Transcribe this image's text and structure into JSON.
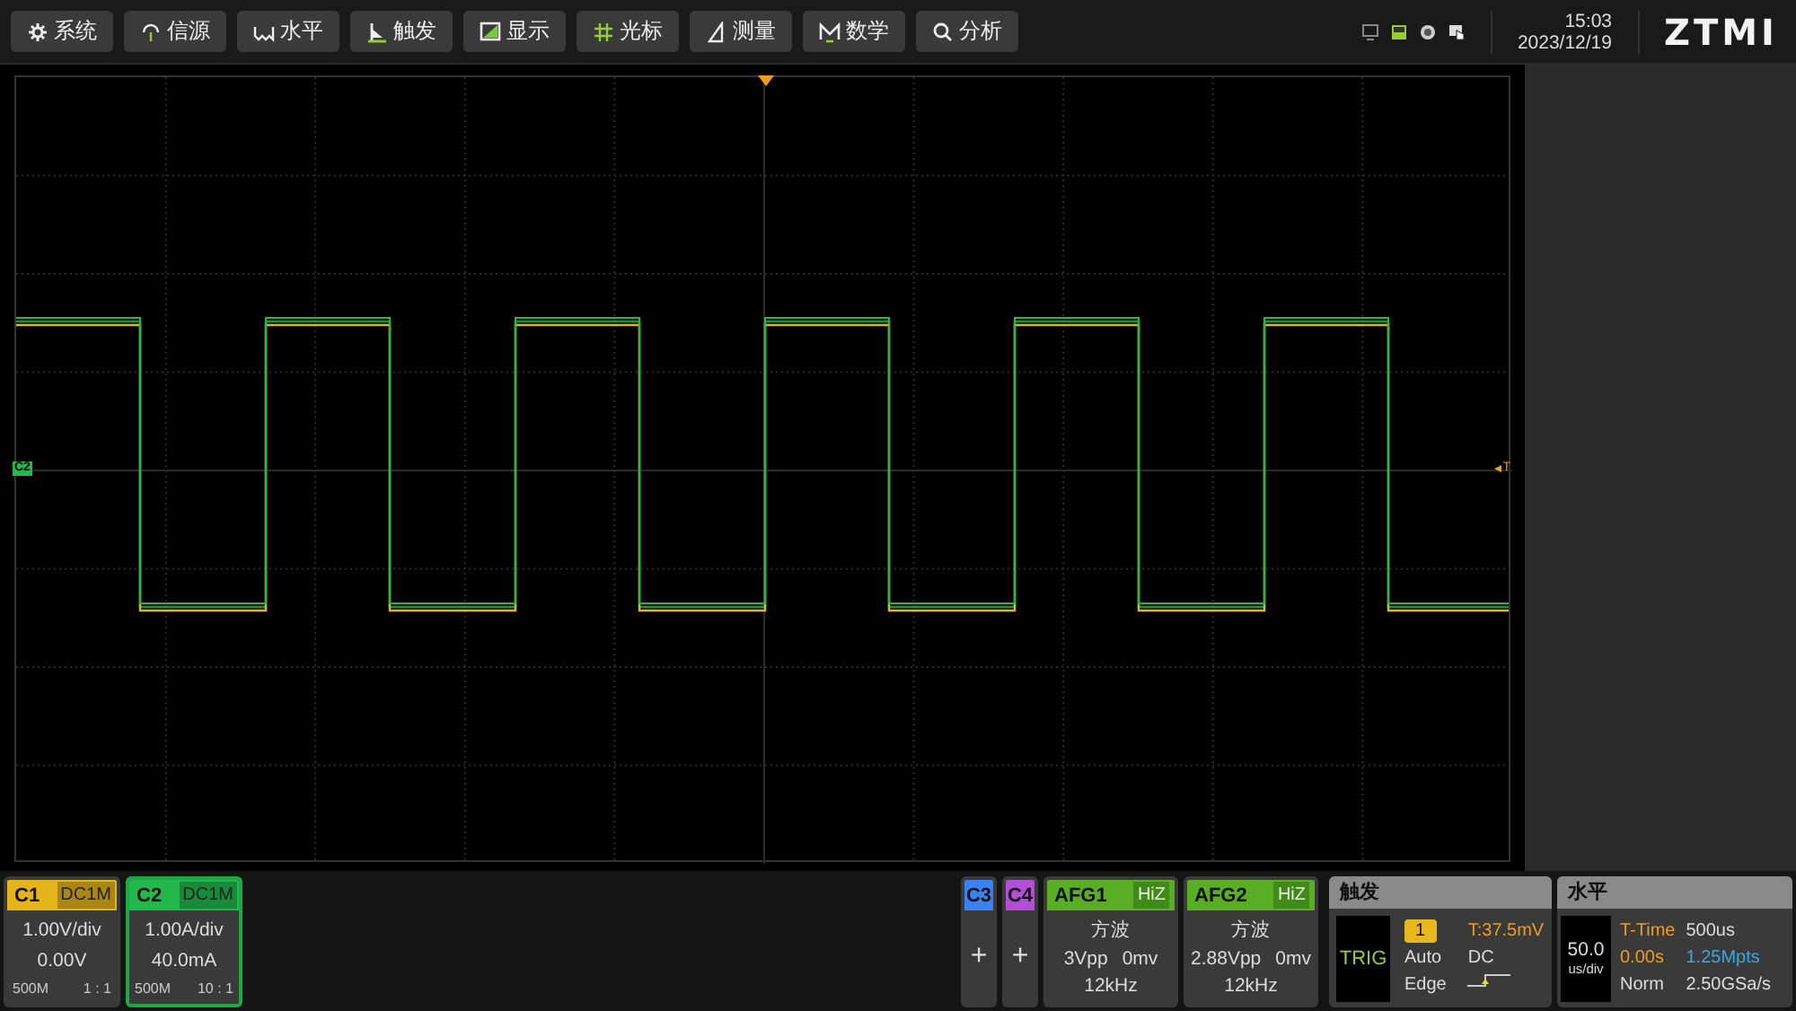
{
  "toolbar": {
    "buttons": [
      {
        "label": "系统"
      },
      {
        "label": "信源"
      },
      {
        "label": "水平"
      },
      {
        "label": "触发"
      },
      {
        "label": "显示"
      },
      {
        "label": "光标"
      },
      {
        "label": "测量"
      },
      {
        "label": "数学"
      },
      {
        "label": "分析"
      }
    ]
  },
  "status": {
    "time": "15:03",
    "date": "2023/12/19",
    "logo": "ZTMI"
  },
  "waveform": {
    "channel_marker": "C2",
    "trigger_marker": "T"
  },
  "channels": [
    {
      "name": "C1",
      "coupling": "DC1M",
      "scale": "1.00V/div",
      "offset": "0.00V",
      "bandwidth": "500M",
      "probe": "1 : 1",
      "color": "#e3b51b",
      "selected": false
    },
    {
      "name": "C2",
      "coupling": "DC1M",
      "scale": "1.00A/div",
      "offset": "40.0mA",
      "bandwidth": "500M",
      "probe": "10 : 1",
      "color": "#22b84c",
      "selected": true
    }
  ],
  "inactive_channels": [
    {
      "name": "C3",
      "action": "+",
      "color": "#3b82f0"
    },
    {
      "name": "C4",
      "action": "+",
      "color": "#b24fd6"
    }
  ],
  "generators": [
    {
      "name": "AFG1",
      "impedance": "HiZ",
      "waveform": "方波",
      "amplitude": "3Vpp",
      "offset": "0mv",
      "frequency": "12kHz"
    },
    {
      "name": "AFG2",
      "impedance": "HiZ",
      "waveform": "方波",
      "amplitude": "2.88Vpp",
      "offset": "0mv",
      "frequency": "12kHz"
    }
  ],
  "trigger": {
    "title": "触发",
    "state": "TRIG",
    "source": "1",
    "level": "T:37.5mV",
    "mode": "Auto",
    "coupling": "DC",
    "type": "Edge"
  },
  "horizontal": {
    "title": "水平",
    "scale": "50.0",
    "scale_unit": "us/div",
    "t_time_label": "T-Time",
    "t_time": "500us",
    "delay": "0.00s",
    "points": "1.25Mpts",
    "acq_mode": "Norm",
    "sample_rate": "2.50GSa/s"
  }
}
